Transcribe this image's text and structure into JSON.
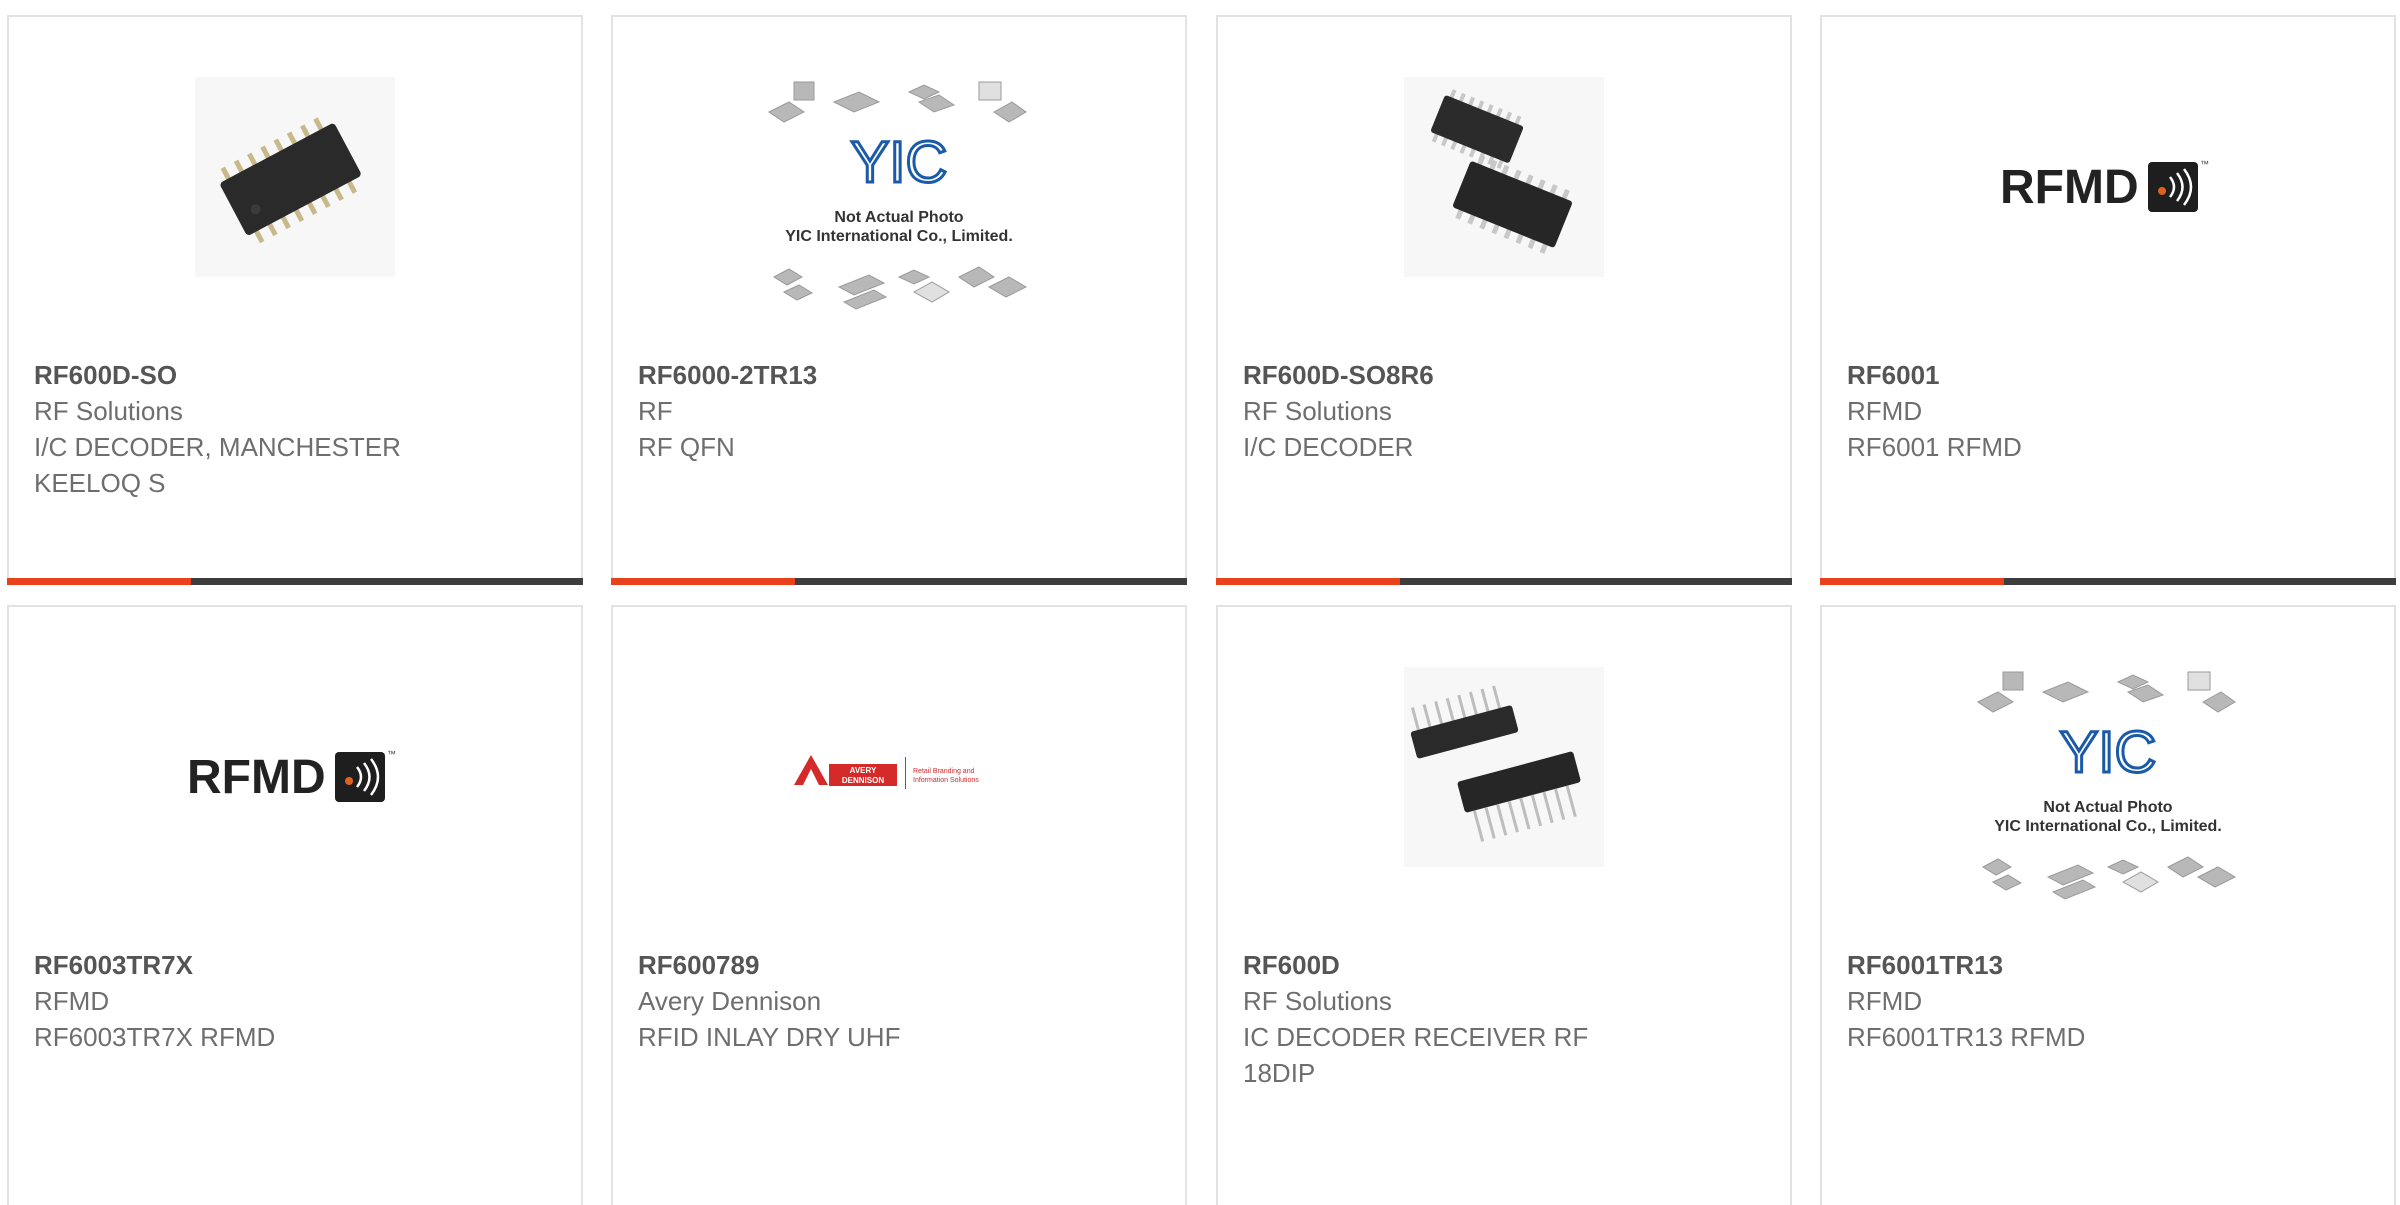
{
  "colors": {
    "accent": "#e8411b",
    "bar": "#3d3d3d",
    "border": "#e2e2e2",
    "text_title": "#555555",
    "text_body": "#6e6e6e"
  },
  "products": [
    {
      "part_number": "RF600D-SO",
      "manufacturer": "RF Solutions",
      "description": "I/C DECODER, MANCHESTER KEELOQ S",
      "image": "soic-chip-photo"
    },
    {
      "part_number": "RF6000-2TR13",
      "manufacturer": "RF",
      "description": "RF QFN",
      "image": "yic-placeholder",
      "placeholder": {
        "brand": "YIC",
        "line1": "Not Actual Photo",
        "line2": "YIC International Co., Limited."
      }
    },
    {
      "part_number": "RF600D-SO8R6",
      "manufacturer": "RF Solutions",
      "description": "I/C DECODER",
      "image": "soic-pair-photo"
    },
    {
      "part_number": "RF6001",
      "manufacturer": "RFMD",
      "description": "RF6001 RFMD",
      "image": "rfmd-logo",
      "logo": {
        "text": "RFMD",
        "tm": "™"
      }
    },
    {
      "part_number": "RF6003TR7X",
      "manufacturer": "RFMD",
      "description": "RF6003TR7X RFMD",
      "image": "rfmd-logo",
      "logo": {
        "text": "RFMD",
        "tm": "™"
      }
    },
    {
      "part_number": "RF600789",
      "manufacturer": "Avery Dennison",
      "description": "RFID INLAY DRY UHF",
      "image": "avery-dennison-logo",
      "logo": {
        "line1": "AVERY",
        "line2": "DENNISON",
        "tag1": "Retail Branding and",
        "tag2": "Information Solutions"
      }
    },
    {
      "part_number": "RF600D",
      "manufacturer": "RF Solutions",
      "description": "IC DECODER RECEIVER RF 18DIP",
      "image": "dip-chip-photo"
    },
    {
      "part_number": "RF6001TR13",
      "manufacturer": "RFMD",
      "description": "RF6001TR13 RFMD",
      "image": "yic-placeholder",
      "placeholder": {
        "brand": "YIC",
        "line1": "Not Actual Photo",
        "line2": "YIC International Co., Limited."
      }
    }
  ]
}
